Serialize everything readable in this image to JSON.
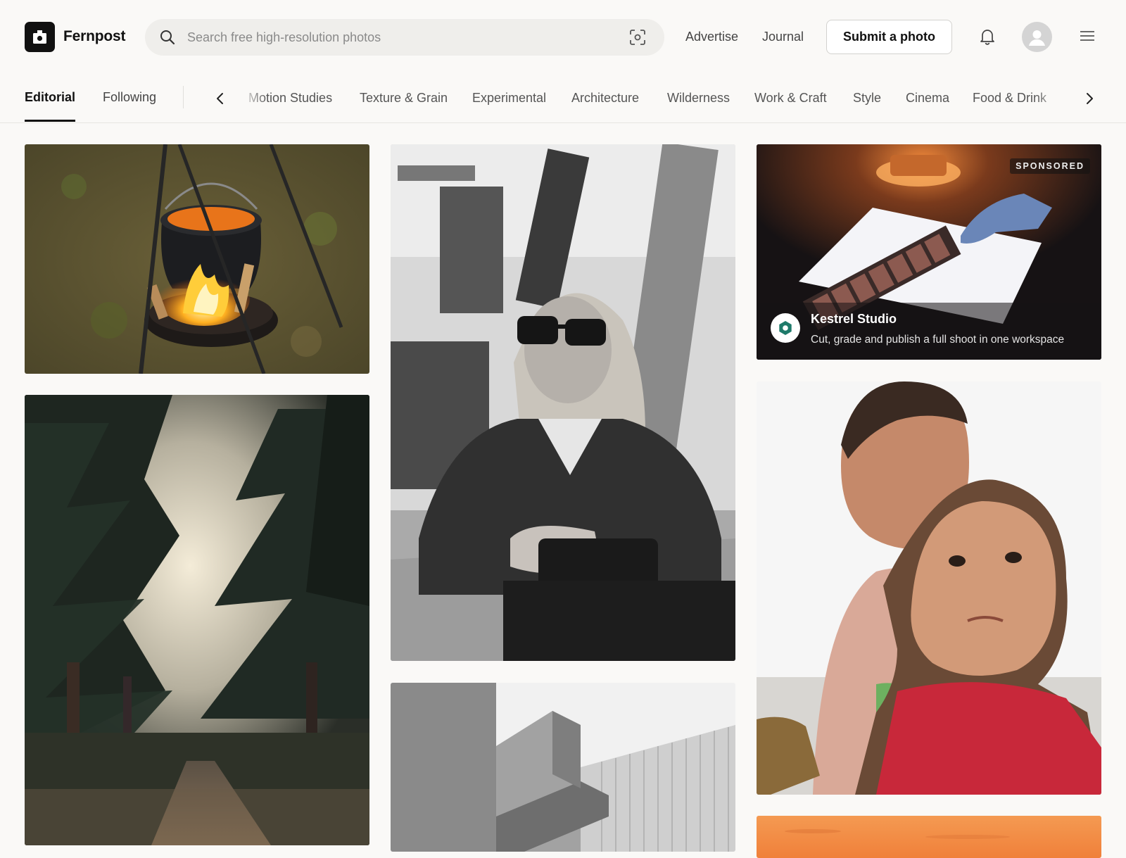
{
  "app": {
    "brand": "Fernpost"
  },
  "search": {
    "placeholder": "Search free high-resolution photos"
  },
  "header": {
    "links": [
      "Advertise",
      "Journal"
    ],
    "submit_label": "Submit a photo"
  },
  "tabs": {
    "primary": [
      {
        "label": "Editorial",
        "active": true
      },
      {
        "label": "Following",
        "active": false
      }
    ],
    "categories": [
      "Motion Studies",
      "Texture & Grain",
      "Experimental",
      "Architecture",
      "Wilderness",
      "Work & Craft",
      "Style",
      "Cinema",
      "Food & Drink"
    ]
  },
  "sponsored": {
    "badge": "SPONSORED",
    "name": "Kestrel Studio",
    "tagline": "Cut, grade and publish a full shoot in one workspace"
  },
  "icons": {
    "logo": "camera-icon",
    "search": "search-icon",
    "visual_search": "scan-icon",
    "notifications": "bell-icon",
    "profile": "avatar-icon",
    "menu": "hamburger-menu-icon",
    "prev": "chevron-left-icon",
    "next": "chevron-right-icon"
  },
  "colors": {
    "background": "#faf9f7",
    "brand": "#111111",
    "search_bg": "#efeeeb",
    "sponsor_accent": "#1e7a6a"
  }
}
